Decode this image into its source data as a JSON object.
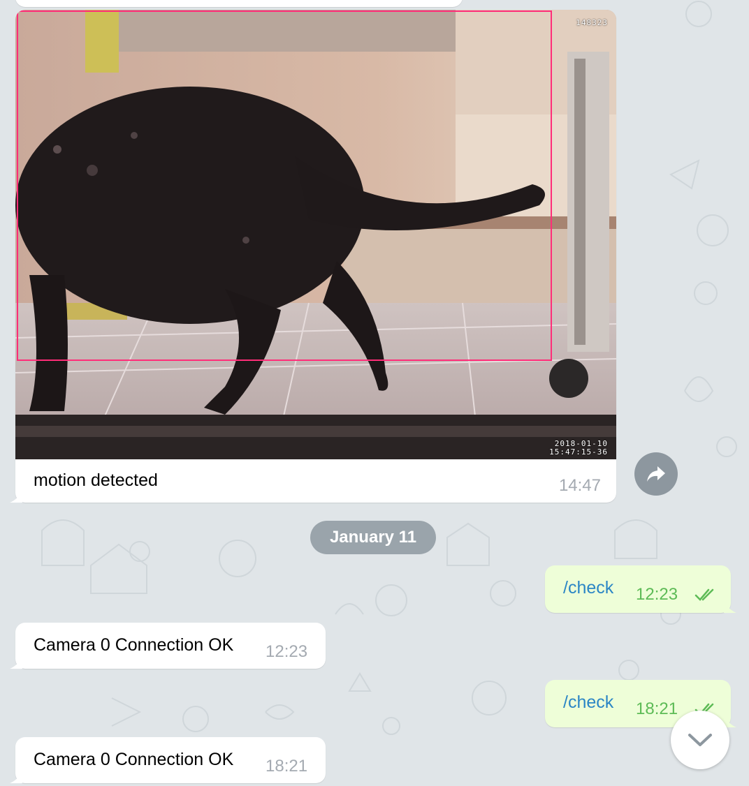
{
  "photo_message": {
    "caption": "motion detected",
    "time": "14:47",
    "camera_id": "148323",
    "camera_date": "2018-01-10",
    "camera_time": "15:47:15-36",
    "highlight_color": "#ff2d78"
  },
  "date_divider": "January 11",
  "messages": [
    {
      "direction": "out",
      "text": "/check",
      "time": "12:23",
      "status_icon": "double-check-icon"
    },
    {
      "direction": "in",
      "text": "Camera 0 Connection OK",
      "time": "12:23"
    },
    {
      "direction": "out",
      "text": "/check",
      "time": "18:21",
      "status_icon": "double-check-icon"
    },
    {
      "direction": "in",
      "text": "Camera 0 Connection OK",
      "time": "18:21"
    }
  ],
  "icons": {
    "forward": "forward-arrow-icon",
    "scroll_down": "chevron-down-icon"
  },
  "colors": {
    "background": "#e0e5e8",
    "incoming_bubble": "#ffffff",
    "outgoing_bubble": "#eefed8",
    "command_link": "#2b86c5",
    "outgoing_time": "#5dbb56",
    "incoming_time": "#a4aab1",
    "date_pill": "#9aa4ab"
  }
}
